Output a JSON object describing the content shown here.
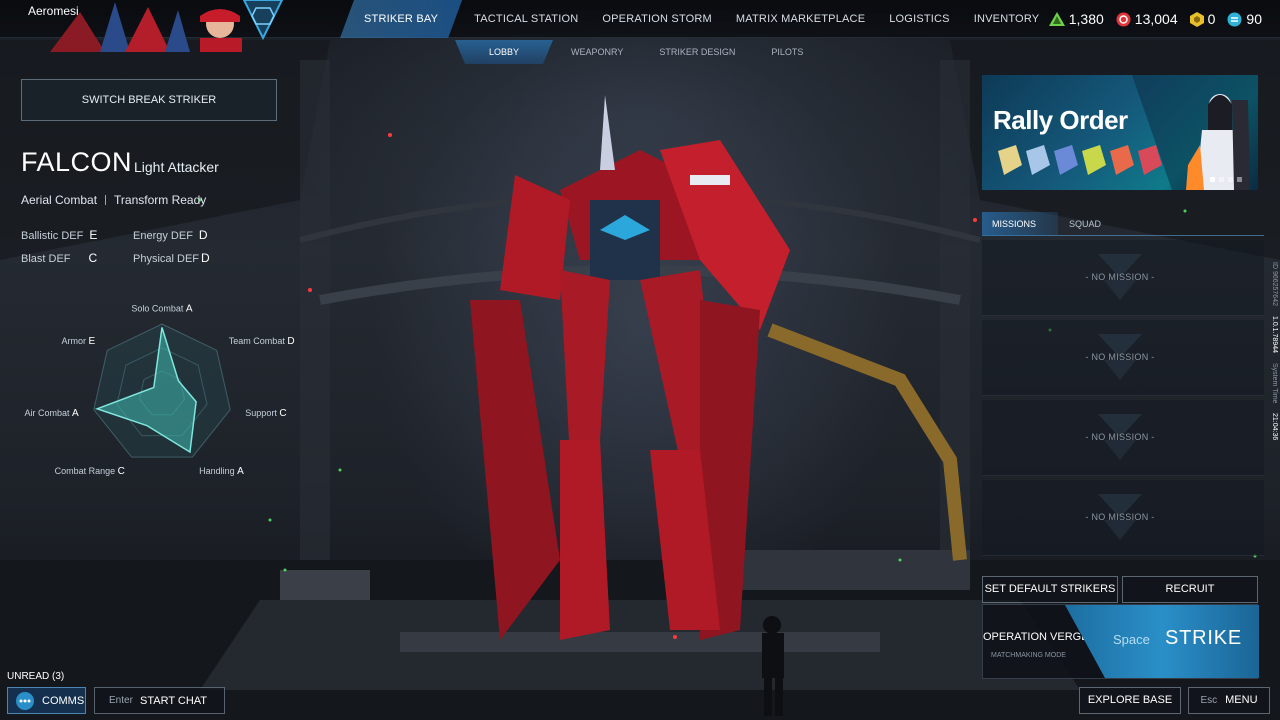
{
  "header": {
    "player_name": "Aeromesi",
    "nav": [
      "STRIKER BAY",
      "TACTICAL STATION",
      "OPERATION STORM",
      "MATRIX MARKETPLACE",
      "LOGISTICS",
      "INVENTORY"
    ],
    "active_nav": "STRIKER BAY",
    "subnav": [
      "LOBBY",
      "WEAPONRY",
      "STRIKER DESIGN",
      "PILOTS"
    ],
    "active_subnav": "LOBBY",
    "currencies": [
      {
        "icon": "green-crystal-icon",
        "value": "1,380",
        "color": "#6fd14a"
      },
      {
        "icon": "red-coin-icon",
        "value": "13,004",
        "color": "#e2343a"
      },
      {
        "icon": "gold-hex-icon",
        "value": "0",
        "color": "#e8c02a"
      },
      {
        "icon": "blue-token-icon",
        "value": "90",
        "color": "#2fb2d6"
      }
    ]
  },
  "striker": {
    "switch_label": "SWITCH BREAK STRIKER",
    "name": "FALCON",
    "class": "Light Attacker",
    "traits": [
      "Aerial Combat",
      "Transform Ready"
    ],
    "defenses": [
      {
        "label": "Ballistic DEF",
        "grade": "E"
      },
      {
        "label": "Energy DEF",
        "grade": "D"
      },
      {
        "label": "Blast DEF",
        "grade": "C"
      },
      {
        "label": "Physical DEF",
        "grade": "D"
      }
    ],
    "radar": {
      "axes": [
        {
          "label": "Solo Combat",
          "grade": "A"
        },
        {
          "label": "Team Combat",
          "grade": "D"
        },
        {
          "label": "Support",
          "grade": "C"
        },
        {
          "label": "Handling",
          "grade": "A"
        },
        {
          "label": "Combat Range",
          "grade": "C"
        },
        {
          "label": "Air Combat",
          "grade": "A"
        },
        {
          "label": "Armor",
          "grade": "E"
        }
      ],
      "levels": [
        0.95,
        0.3,
        0.5,
        0.92,
        0.5,
        0.95,
        0.15
      ]
    }
  },
  "banner": {
    "title": "Rally Order"
  },
  "tabs": [
    "MISSIONS",
    "SQUAD"
  ],
  "active_tab": "MISSIONS",
  "missions": [
    "- NO MISSION -",
    "- NO MISSION -",
    "- NO MISSION -",
    "- NO MISSION -"
  ],
  "side_info": {
    "id": "ID 966257642",
    "version": "1.0.1.78944",
    "label": "System Time",
    "time": "21:04:36"
  },
  "actions": {
    "set_default": "SET DEFAULT STRIKERS",
    "recruit": "RECRUIT",
    "operation": "OPERATION VERGE",
    "matchmaking": "MATCHMAKING MODE",
    "strike_key": "Space",
    "strike": "STRIKE"
  },
  "footer": {
    "unread": "UNREAD (3)",
    "comms": "COMMS",
    "chat_key": "Enter",
    "chat": "START CHAT",
    "explore": "EXPLORE BASE",
    "menu_key": "Esc",
    "menu": "MENU"
  },
  "colors": {
    "accent": "#2a8fc8",
    "radar_fill": "#3fb8b0",
    "mech_red": "#c41f2c"
  }
}
